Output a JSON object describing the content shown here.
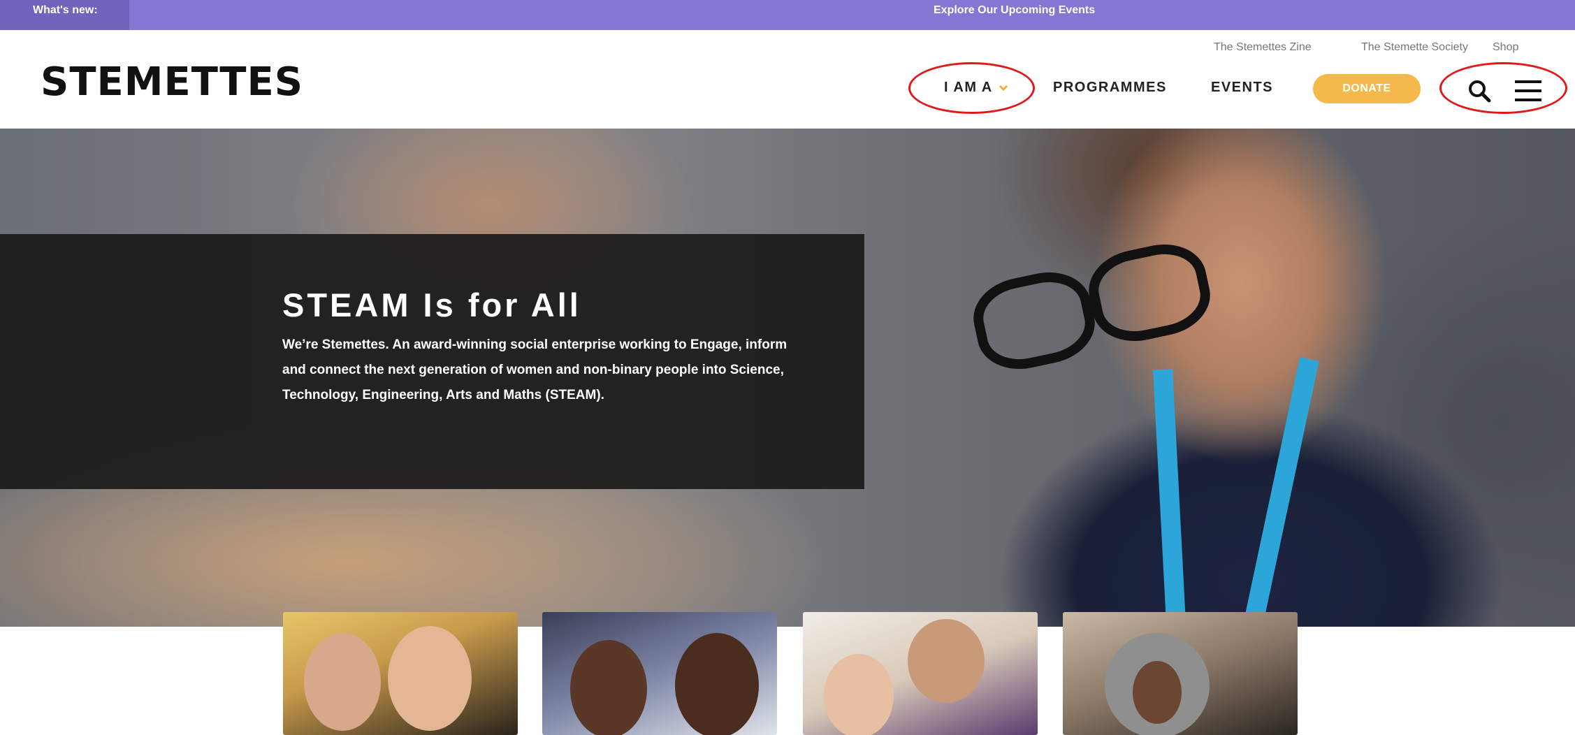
{
  "announcement": {
    "label": "What's new:",
    "link_text": "Explore Our Upcoming Events",
    "bar_color": "#8576d2"
  },
  "header": {
    "logo_text": "STEMETTES",
    "top_links": [
      "The Stemettes Zine",
      "The Stemette Society",
      "Shop"
    ],
    "nav": [
      {
        "label": "I AM A",
        "has_dropdown": true,
        "icon": "chevron-down-icon"
      },
      {
        "label": "PROGRAMMES"
      },
      {
        "label": "EVENTS"
      }
    ],
    "donate_label": "DONATE",
    "donate_color": "#f5b84a",
    "icons": [
      "search-icon",
      "menu-icon"
    ]
  },
  "hero": {
    "title": "STEAM Is for All",
    "text": "We’re Stemettes. An award-winning social enterprise working to Engage, inform and connect the next generation of women and non-binary people into Science, Technology, Engineering, Arts and Maths (STEAM)."
  },
  "cards": [
    {
      "name": "card-photo-1"
    },
    {
      "name": "card-photo-2"
    },
    {
      "name": "card-photo-3"
    },
    {
      "name": "card-photo-4"
    }
  ]
}
